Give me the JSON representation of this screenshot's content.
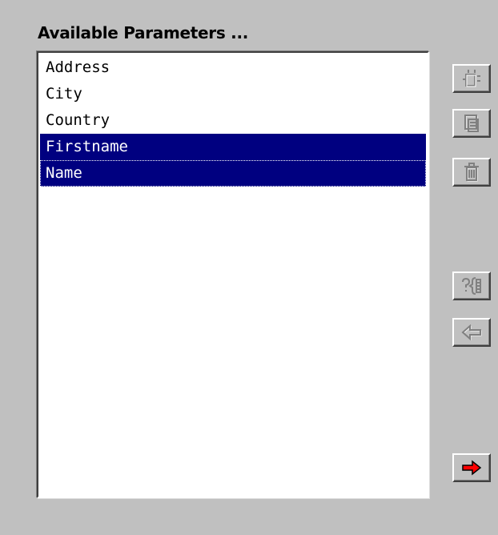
{
  "panel": {
    "heading": "Available Parameters ..."
  },
  "list": {
    "items": [
      {
        "label": "Address",
        "selected": false
      },
      {
        "label": "City",
        "selected": false
      },
      {
        "label": "Country",
        "selected": false
      },
      {
        "label": "Firstname",
        "selected": true
      },
      {
        "label": "Name",
        "selected": true
      }
    ],
    "selection_color": "#000080"
  },
  "toolbar": {
    "buttons": [
      {
        "name": "new-parameter-button",
        "icon": "new-item-icon",
        "enabled": false
      },
      {
        "name": "copy-parameter-button",
        "icon": "copy-icon",
        "enabled": false
      },
      {
        "name": "delete-parameter-button",
        "icon": "trash-icon",
        "enabled": false
      },
      {
        "name": "parameter-help-button",
        "icon": "help-bracket-icon",
        "enabled": false
      },
      {
        "name": "move-left-button",
        "icon": "left-arrow-icon",
        "enabled": false
      },
      {
        "name": "move-right-button",
        "icon": "red-right-arrow-icon",
        "enabled": true
      }
    ]
  }
}
